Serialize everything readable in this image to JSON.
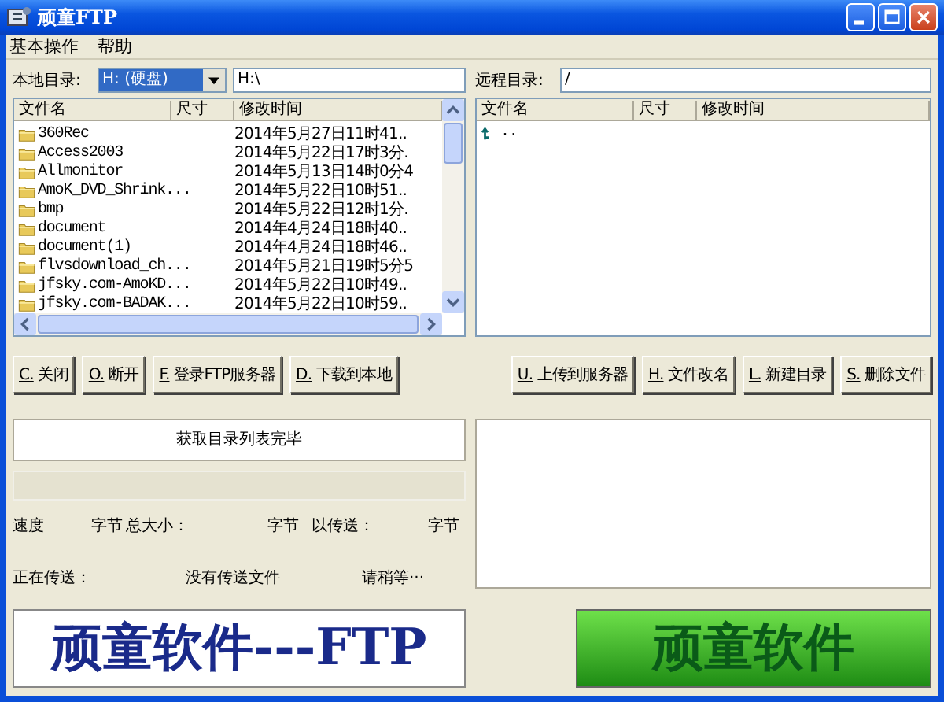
{
  "window": {
    "title": "顽童FTP"
  },
  "menu": [
    {
      "label": "基本操作"
    },
    {
      "label": "帮助"
    }
  ],
  "local": {
    "label": "本地目录:",
    "drive": "H: (硬盘)",
    "path": "H:\\",
    "columns": [
      "文件名",
      "尺寸",
      "修改时间"
    ],
    "rows": [
      {
        "kind": "folder",
        "name": "360Rec",
        "modified": "2014年5月27日11时41.."
      },
      {
        "kind": "folder",
        "name": "Access2003",
        "modified": "2014年5月22日17时3分."
      },
      {
        "kind": "folder",
        "name": "Allmonitor",
        "modified": "2014年5月13日14时0分4"
      },
      {
        "kind": "folder",
        "name": "AmoK_DVD_Shrink...",
        "modified": "2014年5月22日10时51.."
      },
      {
        "kind": "folder",
        "name": "bmp",
        "modified": "2014年5月22日12时1分."
      },
      {
        "kind": "folder",
        "name": "document",
        "modified": "2014年4月24日18时40.."
      },
      {
        "kind": "folder",
        "name": "document(1)",
        "modified": "2014年4月24日18时46.."
      },
      {
        "kind": "folder",
        "name": "flvsdownload_ch...",
        "modified": "2014年5月21日19时5分5"
      },
      {
        "kind": "folder",
        "name": "jfsky.com-AmoKD...",
        "modified": "2014年5月22日10时49.."
      },
      {
        "kind": "folder",
        "name": "jfsky.com-BADAK...",
        "modified": "2014年5月22日10时59.."
      }
    ]
  },
  "remote": {
    "label": "远程目录:",
    "path": "/",
    "columns": [
      "文件名",
      "尺寸",
      "修改时间"
    ],
    "rows": [
      {
        "kind": "parent",
        "name": ".."
      }
    ]
  },
  "buttons_left": [
    "C. 关闭",
    "O. 断开",
    "F. 登录FTP服务器",
    "D. 下载到本地"
  ],
  "buttons_right": [
    "U. 上传到服务器",
    "H. 文件改名",
    "L. 新建目录",
    "S. 删除文件"
  ],
  "status": {
    "message": "获取目录列表完毕",
    "progress": {
      "level": 0
    },
    "line_1": [
      "速度",
      "字节",
      "总大小：",
      "字节",
      "以传送：",
      "字节"
    ],
    "line_2": [
      "正在传送：",
      "没有传送文件",
      "请稍等···"
    ]
  },
  "banners": [
    {
      "kind": "plain",
      "text": "顽童软件---FTP"
    },
    {
      "kind": "gradient",
      "text": "顽童软件"
    }
  ]
}
